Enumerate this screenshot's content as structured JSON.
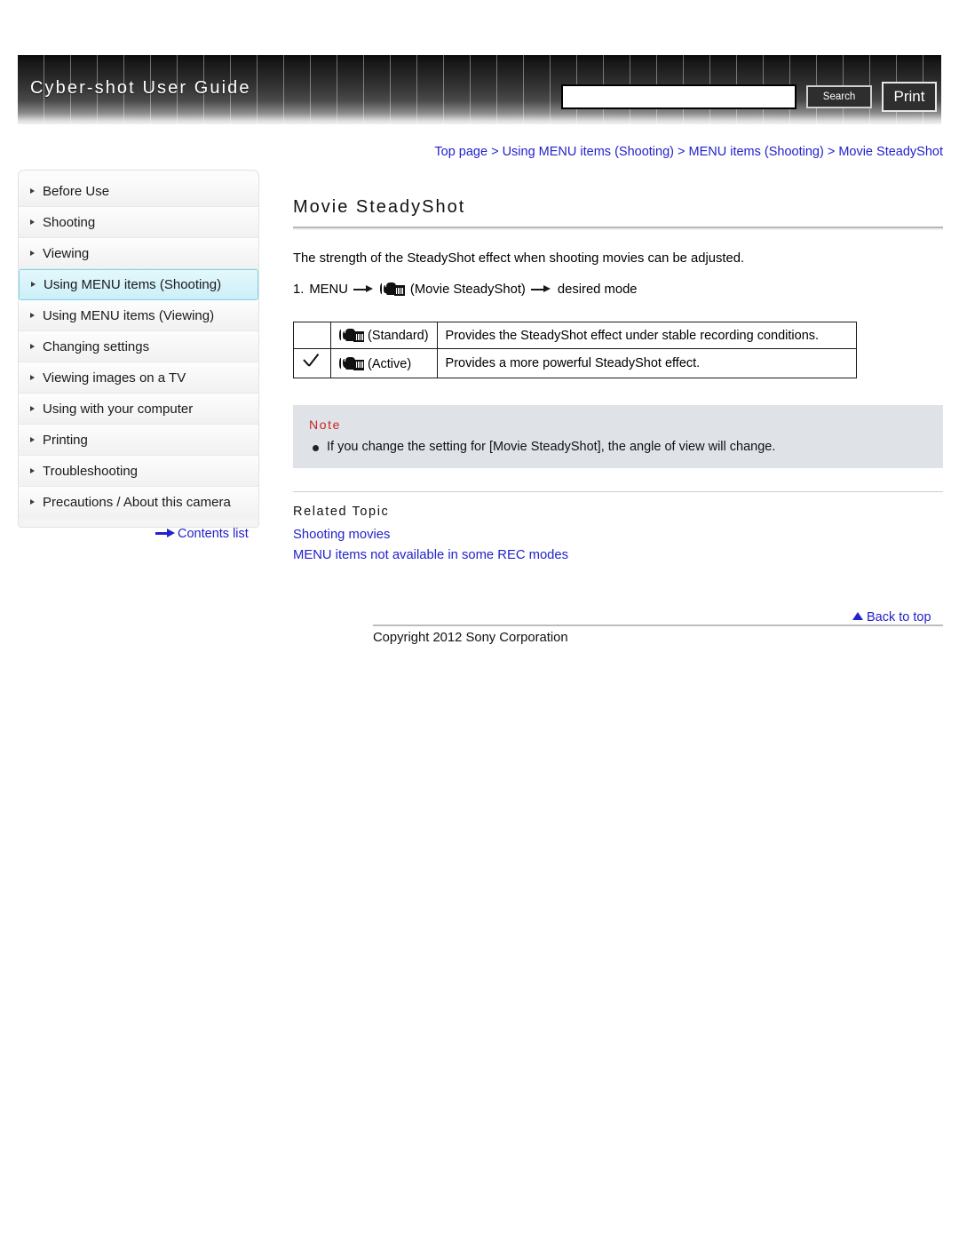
{
  "header": {
    "site_title": "Cyber-shot User Guide",
    "search_value": "",
    "search_placeholder": "",
    "search_label": "Search",
    "print_label": "Print"
  },
  "breadcrumb": {
    "text": "Top page > Using MENU items (Shooting) > MENU items (Shooting) > Movie SteadyShot"
  },
  "sidebar": {
    "items": [
      {
        "label": "Before Use",
        "active": false
      },
      {
        "label": "Shooting",
        "active": false
      },
      {
        "label": "Viewing",
        "active": false
      },
      {
        "label": "Using MENU items (Shooting)",
        "active": true
      },
      {
        "label": "Using MENU items (Viewing)",
        "active": false
      },
      {
        "label": "Changing settings",
        "active": false
      },
      {
        "label": "Viewing images on a TV",
        "active": false
      },
      {
        "label": "Using with your computer",
        "active": false
      },
      {
        "label": "Printing",
        "active": false
      },
      {
        "label": "Troubleshooting",
        "active": false
      },
      {
        "label": "Precautions / About this camera",
        "active": false
      }
    ],
    "contents_list_label": "Contents list"
  },
  "main": {
    "title": "Movie SteadyShot",
    "intro": "The strength of the SteadyShot effect when shooting movies can be adjusted.",
    "step_number": "1.",
    "step_menu": "MENU",
    "step_item": "(Movie SteadyShot)",
    "step_result": "desired mode",
    "table": {
      "rows": [
        {
          "selected": false,
          "mode": "(Standard)",
          "description": "Provides the SteadyShot effect under stable recording conditions."
        },
        {
          "selected": true,
          "mode": "(Active)",
          "description": "Provides a more powerful SteadyShot effect."
        }
      ]
    },
    "note": {
      "heading": "Note",
      "items": [
        "If you change the setting for [Movie SteadyShot], the angle of view will change."
      ]
    },
    "related": {
      "heading": "Related Topic",
      "links": [
        "Shooting movies",
        "MENU items not available in some REC modes"
      ]
    }
  },
  "footer": {
    "back_to_top": "Back to top",
    "copyright": "Copyright 2012 Sony Corporation"
  },
  "colors": {
    "link": "#2222cc",
    "note_heading": "#cc2222",
    "note_background": "#dfe3e8",
    "active_nav": "#cdeff8"
  }
}
